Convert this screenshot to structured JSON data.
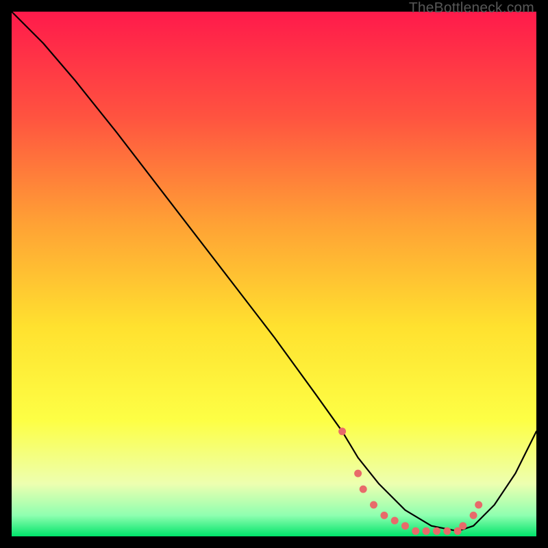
{
  "watermark": "TheBottleneck.com",
  "chart_data": {
    "type": "line",
    "title": "",
    "xlabel": "",
    "ylabel": "",
    "xlim": [
      0,
      100
    ],
    "ylim": [
      0,
      100
    ],
    "background_gradient": {
      "stops": [
        {
          "pos": 0.0,
          "color": "#ff1a4b"
        },
        {
          "pos": 0.2,
          "color": "#ff5340"
        },
        {
          "pos": 0.4,
          "color": "#ffa035"
        },
        {
          "pos": 0.6,
          "color": "#ffe12f"
        },
        {
          "pos": 0.78,
          "color": "#fdff45"
        },
        {
          "pos": 0.9,
          "color": "#edffb0"
        },
        {
          "pos": 0.96,
          "color": "#8fffb0"
        },
        {
          "pos": 1.0,
          "color": "#00e46a"
        }
      ]
    },
    "series": [
      {
        "name": "curve",
        "stroke": "#000000",
        "x": [
          0,
          6,
          12,
          20,
          30,
          40,
          50,
          58,
          63,
          66,
          70,
          75,
          80,
          85,
          88,
          92,
          96,
          100
        ],
        "y": [
          100,
          94,
          87,
          77,
          64,
          51,
          38,
          27,
          20,
          15,
          10,
          5,
          2,
          1,
          2,
          6,
          12,
          20
        ]
      }
    ],
    "markers": {
      "name": "dots",
      "color": "#e86a6a",
      "x": [
        63,
        66,
        67,
        69,
        71,
        73,
        75,
        77,
        79,
        81,
        83,
        85,
        86,
        88,
        89
      ],
      "y": [
        20,
        12,
        9,
        6,
        4,
        3,
        2,
        1,
        1,
        1,
        1,
        1,
        2,
        4,
        6
      ]
    }
  }
}
